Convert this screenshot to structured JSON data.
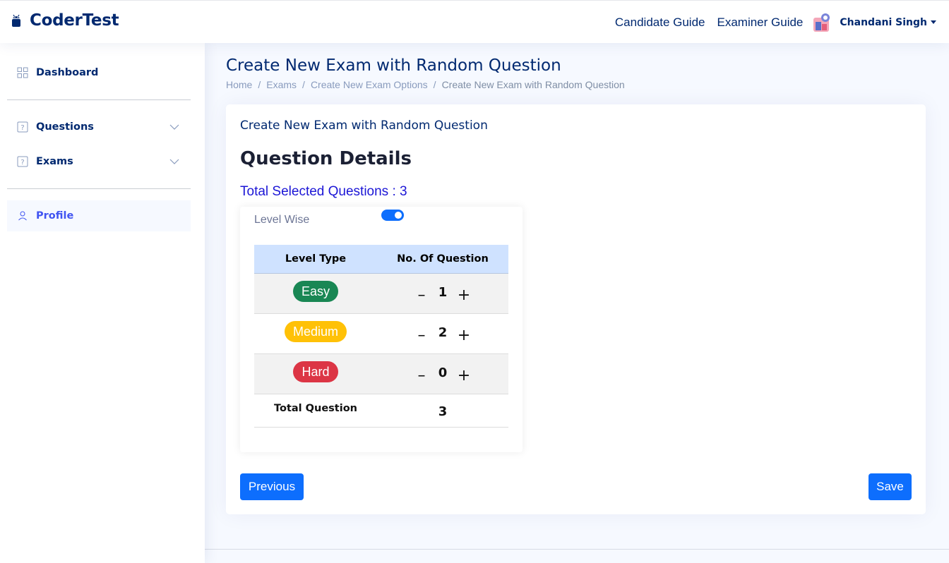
{
  "header": {
    "brand": "CoderTest",
    "links": [
      "Candidate Guide",
      "Examiner Guide"
    ],
    "user_name": "Chandani Singh"
  },
  "sidebar": {
    "items": [
      {
        "label": "Dashboard",
        "icon": "grid-icon"
      },
      {
        "label": "Questions",
        "icon": "question-square-icon"
      },
      {
        "label": "Exams",
        "icon": "question-square-icon"
      },
      {
        "label": "Profile",
        "icon": "person-icon"
      }
    ]
  },
  "page": {
    "title": "Create New Exam with Random Question",
    "breadcrumb": [
      "Home",
      "Exams",
      "Create New Exam Options",
      "Create New Exam with Random Question"
    ]
  },
  "card": {
    "title": "Create New Exam with Random Question",
    "section_title": "Question Details",
    "total_selected": "Total Selected Questions : 3",
    "level_wise_label": "Level Wise",
    "level_wise_on": true,
    "table": {
      "headers": [
        "Level Type",
        "No. Of Question"
      ],
      "rows": [
        {
          "level": "Easy",
          "color": "#198754",
          "count": "1"
        },
        {
          "level": "Medium",
          "color": "#ffc107",
          "count": "2"
        },
        {
          "level": "Hard",
          "color": "#dc3545",
          "count": "0"
        }
      ],
      "total_label": "Total Question",
      "total_value": "3"
    },
    "stepper": {
      "minus": "–",
      "plus": "+"
    },
    "buttons": {
      "previous": "Previous",
      "save": "Save"
    }
  },
  "colors": {
    "brand": "#012970",
    "primary": "#0d6efd",
    "table_head": "#cfe2ff"
  }
}
